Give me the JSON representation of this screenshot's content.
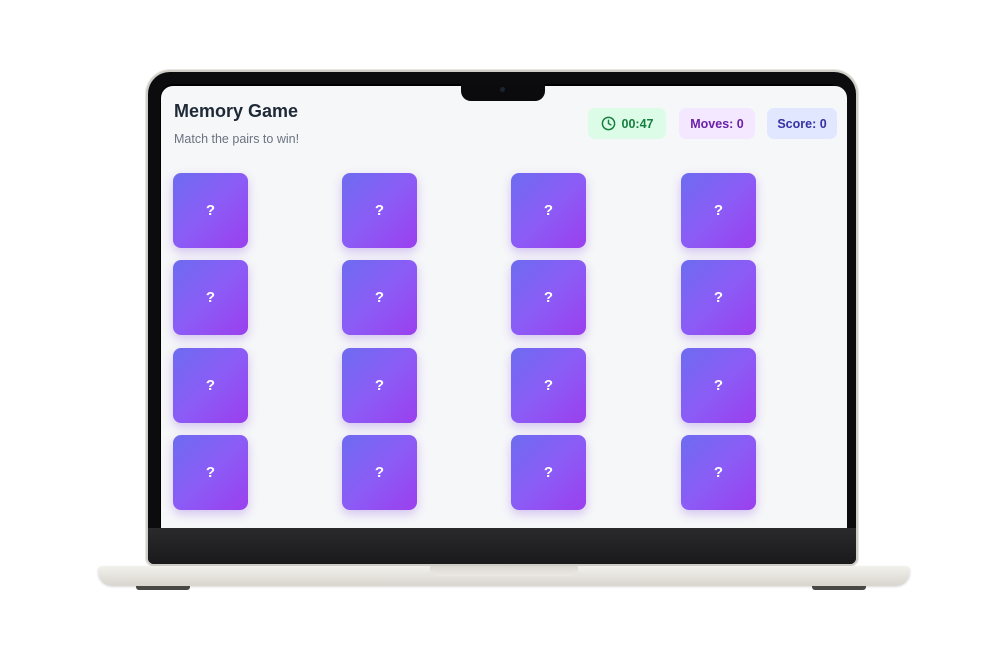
{
  "app": {
    "title": "Memory Game",
    "subtitle": "Match the pairs to win!"
  },
  "stats": {
    "timer": "00:47",
    "moves": "Moves: 0",
    "score": "Score: 0"
  },
  "board": {
    "rows": 4,
    "cols": 4,
    "cards": [
      "?",
      "?",
      "?",
      "?",
      "?",
      "?",
      "?",
      "?",
      "?",
      "?",
      "?",
      "?",
      "?",
      "?",
      "?",
      "?"
    ]
  },
  "colors": {
    "card_gradient_start": "#6d6cf0",
    "card_gradient_end": "#9b3fee",
    "timer_bg": "#dcfce7",
    "moves_bg": "#f3e8ff",
    "score_bg": "#e0e7ff"
  },
  "icons": {
    "timer": "clock-icon"
  }
}
